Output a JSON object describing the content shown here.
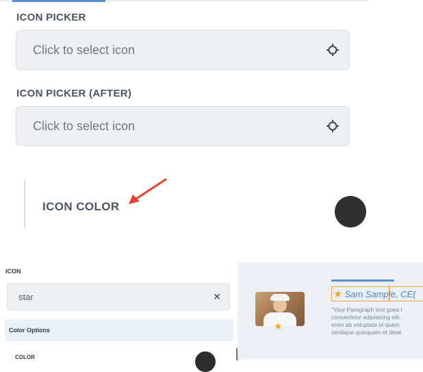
{
  "icon_picker": {
    "label": "ICON PICKER",
    "placeholder": "Click to select icon"
  },
  "icon_picker_after": {
    "label": "ICON PICKER (AFTER)",
    "placeholder": "Click to select icon"
  },
  "icon_color": {
    "label": "ICON COLOR",
    "swatch_color": "#2f3031"
  },
  "settings_panel": {
    "icon_label": "ICON",
    "icon_value": "star",
    "clear_symbol": "✕",
    "section_title": "Color Options",
    "color_label": "COLOR"
  },
  "preview": {
    "name": "Sam Sample, CE(",
    "paragraph": "\"Your Paragraph text goes l\nconsectetur adipisicing elit.\nenim ab voluptate id quam\nsimilique quisquam et dese",
    "star_color": "#f5a623",
    "accent_color": "#5b8fd8"
  },
  "icons": {
    "target": "crosshair-icon",
    "arrow": "red-arrow-annotation",
    "star": "star-icon"
  }
}
